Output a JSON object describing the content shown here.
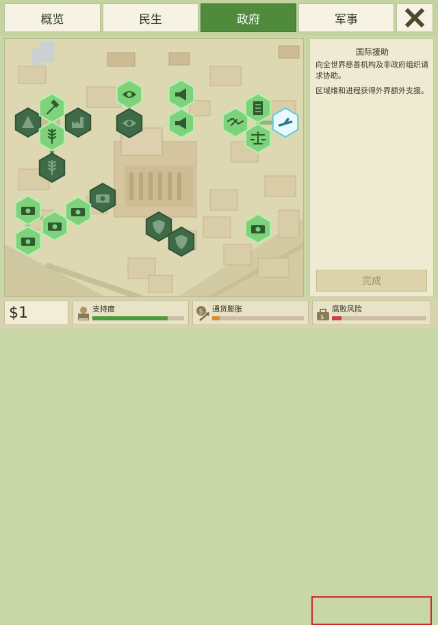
{
  "tabs": [
    {
      "label": "概览",
      "active": false
    },
    {
      "label": "民生",
      "active": false
    },
    {
      "label": "政府",
      "active": true
    },
    {
      "label": "军事",
      "active": false
    }
  ],
  "close_icon": "close-x-icon",
  "policies": [
    {
      "name": "hierarchy-policy-icon",
      "unlocked": false
    },
    {
      "name": "hammer-policy-icon",
      "unlocked": true
    },
    {
      "name": "factory-policy-icon",
      "unlocked": false
    },
    {
      "name": "wheat-leaf-policy-icon",
      "unlocked": true
    },
    {
      "name": "wheat-policy-icon",
      "unlocked": false
    },
    {
      "name": "eye-policy-icon",
      "unlocked": true
    },
    {
      "name": "surveillance-policy-icon",
      "unlocked": false
    },
    {
      "name": "megaphone-policy-icon",
      "unlocked": true
    },
    {
      "name": "megaphone-star-policy-icon",
      "unlocked": true
    },
    {
      "name": "handshake-policy-icon",
      "unlocked": true
    },
    {
      "name": "document-policy-icon",
      "unlocked": true
    },
    {
      "name": "scales-policy-icon",
      "unlocked": true
    },
    {
      "name": "aid-plane-policy-icon",
      "unlocked": true,
      "selected": true
    },
    {
      "name": "bank-policy-icon",
      "unlocked": false
    },
    {
      "name": "money-cut-policy-icon",
      "unlocked": true
    },
    {
      "name": "tax-policy-icon",
      "unlocked": true
    },
    {
      "name": "money-stack-policy-icon",
      "unlocked": true
    },
    {
      "name": "money-pile-policy-icon",
      "unlocked": true
    },
    {
      "name": "shield-policy-icon",
      "unlocked": false
    },
    {
      "name": "defense-policy-icon",
      "unlocked": false
    },
    {
      "name": "money-briefcase-policy-icon",
      "unlocked": true
    }
  ],
  "info": {
    "title": "国际援助",
    "description": "向全世界慈善机构及非政府组织请求协助。",
    "note": "区域维和进程获得外界额外支援。",
    "done_label": "完成"
  },
  "status": {
    "money": "$1",
    "support": {
      "label": "支持度",
      "icon": "support-icon",
      "level": 0.82,
      "color": "#4c9b3c"
    },
    "inflation": {
      "label": "通货膨胀",
      "icon": "inflation-icon",
      "level": 0.08,
      "color": "#e08a2e"
    },
    "corruption": {
      "label": "腐败风险",
      "icon": "corruption-icon",
      "level": 0.1,
      "color": "#d23a4a",
      "highlighted": true
    }
  }
}
